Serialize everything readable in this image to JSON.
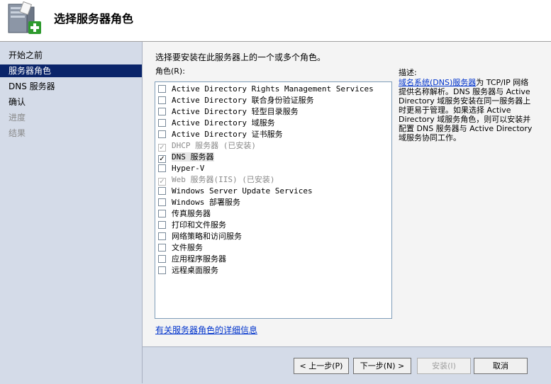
{
  "header": {
    "title": "选择服务器角色",
    "icon": "server-add-icon"
  },
  "nav": {
    "items": [
      {
        "label": "开始之前",
        "state": "normal"
      },
      {
        "label": "服务器角色",
        "state": "active"
      },
      {
        "label": "DNS 服务器",
        "state": "normal"
      },
      {
        "label": "确认",
        "state": "normal"
      },
      {
        "label": "进度",
        "state": "disabled"
      },
      {
        "label": "结果",
        "state": "disabled"
      }
    ]
  },
  "main": {
    "instruction": "选择要安装在此服务器上的一个或多个角色。",
    "roles_label": "角色(R):",
    "roles": [
      {
        "label": "Active Directory Rights Management Services",
        "checked": false,
        "installed": false
      },
      {
        "label": "Active Directory 联合身份验证服务",
        "checked": false,
        "installed": false
      },
      {
        "label": "Active Directory 轻型目录服务",
        "checked": false,
        "installed": false
      },
      {
        "label": "Active Directory 域服务",
        "checked": false,
        "installed": false
      },
      {
        "label": "Active Directory 证书服务",
        "checked": false,
        "installed": false
      },
      {
        "label": "DHCP 服务器  (已安装)",
        "checked": true,
        "installed": true
      },
      {
        "label": "DNS 服务器",
        "checked": true,
        "installed": false,
        "selected": true
      },
      {
        "label": "Hyper-V",
        "checked": false,
        "installed": false
      },
      {
        "label": "Web 服务器(IIS)  (已安装)",
        "checked": true,
        "installed": true
      },
      {
        "label": "Windows Server Update Services",
        "checked": false,
        "installed": false
      },
      {
        "label": "Windows 部署服务",
        "checked": false,
        "installed": false
      },
      {
        "label": "传真服务器",
        "checked": false,
        "installed": false
      },
      {
        "label": "打印和文件服务",
        "checked": false,
        "installed": false
      },
      {
        "label": "网络策略和访问服务",
        "checked": false,
        "installed": false
      },
      {
        "label": "文件服务",
        "checked": false,
        "installed": false
      },
      {
        "label": "应用程序服务器",
        "checked": false,
        "installed": false
      },
      {
        "label": "远程桌面服务",
        "checked": false,
        "installed": false
      }
    ],
    "description_title": "描述:",
    "description_link": "域名系统(DNS)服务器",
    "description_text": "为 TCP/IP 网络提供名称解析。DNS 服务器与 Active Directory 域服务安装在同一服务器上时更易于管理。如果选择 Active Directory 域服务角色，则可以安装并配置 DNS 服务器与 Active Directory 域服务协同工作。",
    "more_info_link": "有关服务器角色的详细信息"
  },
  "footer": {
    "prev_label": "< 上一步(P)",
    "next_label": "下一步(N) >",
    "install_label": "安装(I)",
    "cancel_label": "取消"
  },
  "colors": {
    "nav_bg": "#d4dbe8",
    "nav_active_bg": "#0a246a",
    "link": "#0033cc",
    "content_bg": "#f4f4f4"
  }
}
